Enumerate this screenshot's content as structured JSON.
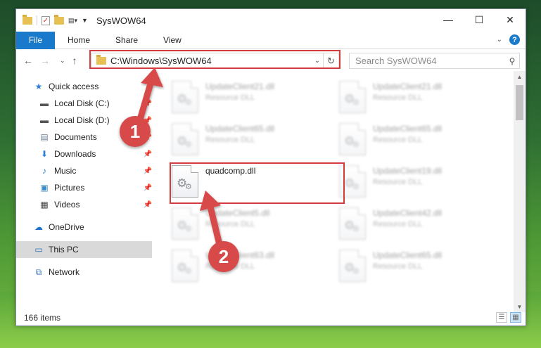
{
  "window": {
    "title": "SysWOW64",
    "controls": {
      "minimize": "—",
      "maximize": "☐",
      "close": "✕"
    }
  },
  "ribbon": {
    "tabs": [
      "File",
      "Home",
      "Share",
      "View"
    ],
    "help": "?"
  },
  "nav": {
    "back": "←",
    "forward": "→",
    "recent": "⌄",
    "up": "↑",
    "address": "C:\\Windows\\SysWOW64",
    "refresh": "↻",
    "search_placeholder": "Search SysWOW64"
  },
  "sidebar": {
    "items": [
      {
        "label": "Quick access",
        "icon": "star-icon",
        "pinned": false
      },
      {
        "label": "Local Disk (C:)",
        "icon": "drive-icon",
        "pinned": true
      },
      {
        "label": "Local Disk (D:)",
        "icon": "drive-icon",
        "pinned": true
      },
      {
        "label": "Documents",
        "icon": "documents-icon",
        "pinned": true
      },
      {
        "label": "Downloads",
        "icon": "download-icon",
        "pinned": true
      },
      {
        "label": "Music",
        "icon": "music-icon",
        "pinned": true
      },
      {
        "label": "Pictures",
        "icon": "pictures-icon",
        "pinned": true
      },
      {
        "label": "Videos",
        "icon": "videos-icon",
        "pinned": true
      },
      {
        "label": "OneDrive",
        "icon": "cloud-icon",
        "pinned": false
      },
      {
        "label": "This PC",
        "icon": "computer-icon",
        "pinned": false,
        "selected": true
      },
      {
        "label": "Network",
        "icon": "network-icon",
        "pinned": false
      }
    ]
  },
  "files": [
    {
      "name": "UpdateClient21.dll",
      "type": "Resource DLL",
      "blurred": true
    },
    {
      "name": "UpdateClient21.dll",
      "type": "Resource DLL",
      "blurred": true
    },
    {
      "name": "UpdateClient65.dll",
      "type": "Resource DLL",
      "blurred": true
    },
    {
      "name": "UpdateClient65.dll",
      "type": "Resource DLL",
      "blurred": true
    },
    {
      "name": "quadcomp.dll",
      "type": "",
      "blurred": false,
      "highlighted": true
    },
    {
      "name": "UpdateClient19.dll",
      "type": "Resource DLL",
      "blurred": true
    },
    {
      "name": "UpdateClient5.dll",
      "type": "Resource DLL",
      "blurred": true
    },
    {
      "name": "UpdateClient42.dll",
      "type": "Resource DLL",
      "blurred": true
    },
    {
      "name": "UpdateClient63.dll",
      "type": "Resource DLL",
      "blurred": true
    },
    {
      "name": "UpdateClient65.dll",
      "type": "Resource DLL",
      "blurred": true
    }
  ],
  "status": {
    "item_count": "166 items"
  },
  "annotations": {
    "step1": "1",
    "step2": "2",
    "color": "#d23c3c"
  }
}
